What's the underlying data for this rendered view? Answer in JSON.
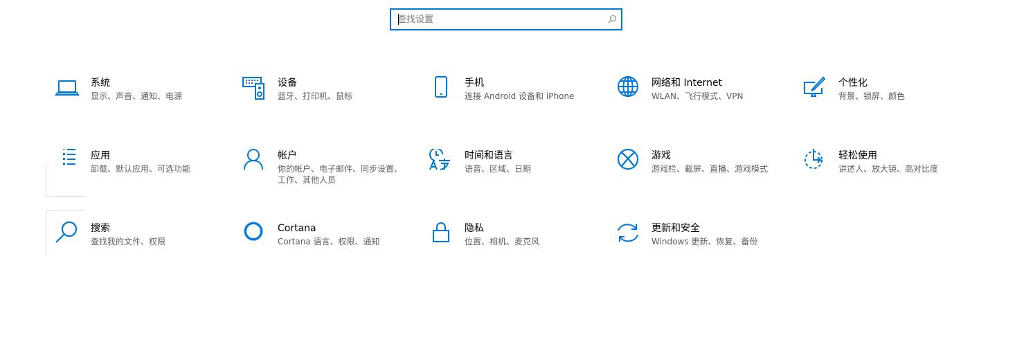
{
  "search": {
    "placeholder": "查找设置"
  },
  "colors": {
    "accent": "#0078d7",
    "title_text": "#000000",
    "description_text": "#5f5f5f"
  },
  "tiles": [
    {
      "title": "系统",
      "description": "显示、声音、通知、电源",
      "icon": "laptop-icon"
    },
    {
      "title": "设备",
      "description": "蓝牙、打印机、鼠标",
      "icon": "devices-keyboard-speaker-icon"
    },
    {
      "title": "手机",
      "description": "连接 Android 设备和 iPhone",
      "icon": "phone-icon"
    },
    {
      "title": "网络和 Internet",
      "description": "WLAN、飞行模式、VPN",
      "icon": "globe-icon"
    },
    {
      "title": "个性化",
      "description": "背景、锁屏、颜色",
      "icon": "paint-monitor-icon"
    },
    {
      "title": "应用",
      "description": "卸载、默认应用、可选功能",
      "icon": "app-list-icon"
    },
    {
      "title": "帐户",
      "description": "你的帐户、电子邮件、同步设置、工作、其他人员",
      "icon": "person-icon"
    },
    {
      "title": "时间和语言",
      "description": "语音、区域、日期",
      "icon": "time-language-icon"
    },
    {
      "title": "游戏",
      "description": "游戏栏、截屏、直播、游戏模式",
      "icon": "xbox-icon"
    },
    {
      "title": "轻松使用",
      "description": "讲述人、放大镜、高对比度",
      "icon": "ease-of-access-icon"
    },
    {
      "title": "搜索",
      "description": "查找我的文件、权限",
      "icon": "search-magnifier-icon"
    },
    {
      "title": "Cortana",
      "description": "Cortana 语言、权限、通知",
      "icon": "cortana-ring-icon"
    },
    {
      "title": "隐私",
      "description": "位置、相机、麦克风",
      "icon": "lock-icon"
    },
    {
      "title": "更新和安全",
      "description": "Windows 更新、恢复、备份",
      "icon": "sync-arrows-icon"
    }
  ]
}
